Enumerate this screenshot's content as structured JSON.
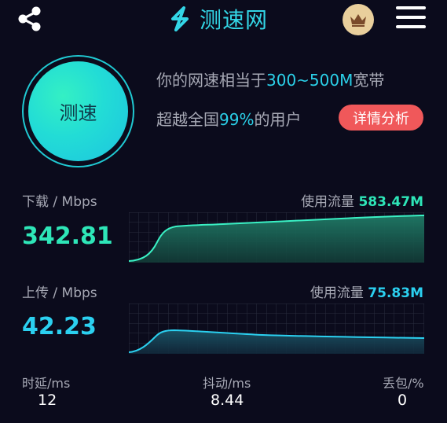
{
  "header": {
    "app_name": "测速网"
  },
  "test_button": {
    "label": "测速"
  },
  "summary": {
    "line1_prefix": "你的网速相当于",
    "line1_value": "300~500M",
    "line1_suffix": "宽带",
    "line2_prefix": "超越全国",
    "line2_value": "99%",
    "line2_suffix": "的用户",
    "detail_button": "详情分析"
  },
  "download": {
    "label": "下载 / Mbps",
    "value": "342.81",
    "usage_label": "使用流量",
    "usage_value": "583.47M"
  },
  "upload": {
    "label": "上传 / Mbps",
    "value": "42.23",
    "usage_label": "使用流量",
    "usage_value": "75.83M"
  },
  "stats": {
    "latency_label": "时延/ms",
    "latency_value": "12",
    "jitter_label": "抖动/ms",
    "jitter_value": "8.44",
    "loss_label": "丢包/%",
    "loss_value": "0"
  },
  "colors": {
    "accent": "#2bd0e8",
    "download": "#2ee6b8",
    "upload": "#2bd0f0",
    "danger": "#f0585a"
  },
  "icons": {
    "share": "share-icon",
    "crown": "crown-icon",
    "menu": "menu-icon"
  }
}
